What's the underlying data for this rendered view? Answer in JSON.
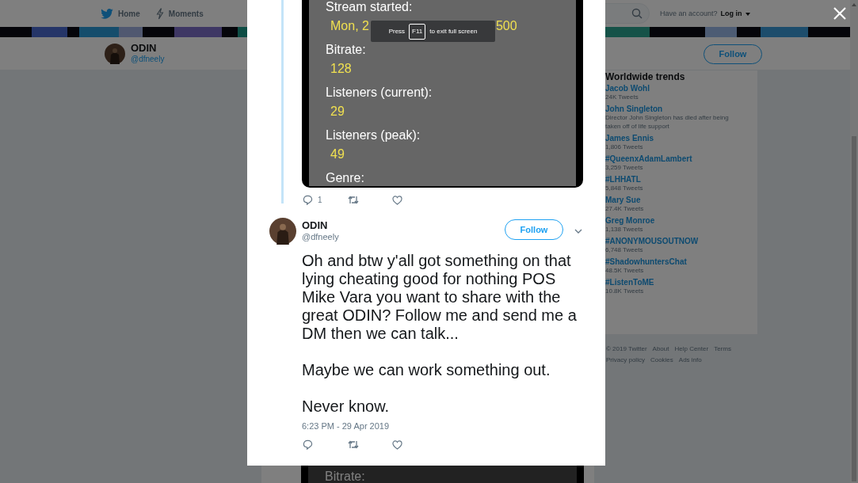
{
  "nav": {
    "items": [
      {
        "label": "Home",
        "kind": "bird"
      },
      {
        "label": "Moments",
        "kind": "bolt"
      }
    ]
  },
  "account_prompt": {
    "text": "Have an account?",
    "link": "Log in"
  },
  "profile": {
    "name": "ODIN",
    "handle": "@dfneely",
    "follow": "Follow"
  },
  "trends": {
    "title": "Worldwide trends",
    "items": [
      {
        "name": "Jacob Wohl",
        "meta": "24K Tweets"
      },
      {
        "name": "John Singleton",
        "meta": "Director John Singleton has died after being taken off of life support"
      },
      {
        "name": "James Ennis",
        "meta": "1,806 Tweets"
      },
      {
        "name": "#QueenxAdamLambert",
        "meta": "3,259 Tweets"
      },
      {
        "name": "#LHHATL",
        "meta": "5,848 Tweets"
      },
      {
        "name": "Mary Sue",
        "meta": "27.4K Tweets"
      },
      {
        "name": "Greg Monroe",
        "meta": "1,138 Tweets"
      },
      {
        "name": "#ANONYMOUSOUTNOW",
        "meta": "6,748 Tweets"
      },
      {
        "name": "#ShadowhuntersChat",
        "meta": "48.5K Tweets"
      },
      {
        "name": "#ListenToME",
        "meta": "10.8K Tweets"
      }
    ]
  },
  "footer": {
    "lines": [
      [
        "© 2019 Twitter",
        "About",
        "Help Center",
        "Terms"
      ],
      [
        "Privacy policy",
        "Cookies",
        "Ads info"
      ]
    ]
  },
  "background_tweet": {
    "image_text": "Bitrate:"
  },
  "modal": {
    "parent_tweet": {
      "image": {
        "rows": [
          {
            "kind": "label",
            "text": "Stream started:"
          },
          {
            "kind": "covered_value",
            "parts": [
              "Mon, 2",
              "500"
            ]
          },
          {
            "kind": "label",
            "text": "Bitrate:"
          },
          {
            "kind": "value",
            "text": "128"
          },
          {
            "kind": "label",
            "text": "Listeners (current):"
          },
          {
            "kind": "value",
            "text": "29"
          },
          {
            "kind": "label",
            "text": "Listeners (peak):"
          },
          {
            "kind": "value",
            "text": "49"
          },
          {
            "kind": "label",
            "text": "Genre:"
          }
        ]
      },
      "reply_count": "1"
    },
    "tweet": {
      "name": "ODIN",
      "handle": "@dfneely",
      "follow": "Follow",
      "paragraphs": [
        "Oh and btw y'all got something on that lying cheating good for nothing POS Mike Vara you want to share with the great ODIN? Follow me and send me a DM then we can talk...",
        "Maybe we can work something out.",
        "Never know."
      ],
      "timestamp": "6:23 PM - 29 Apr 2019"
    }
  },
  "toast": {
    "before": "Press",
    "key": "F11",
    "after": "to exit full screen"
  }
}
